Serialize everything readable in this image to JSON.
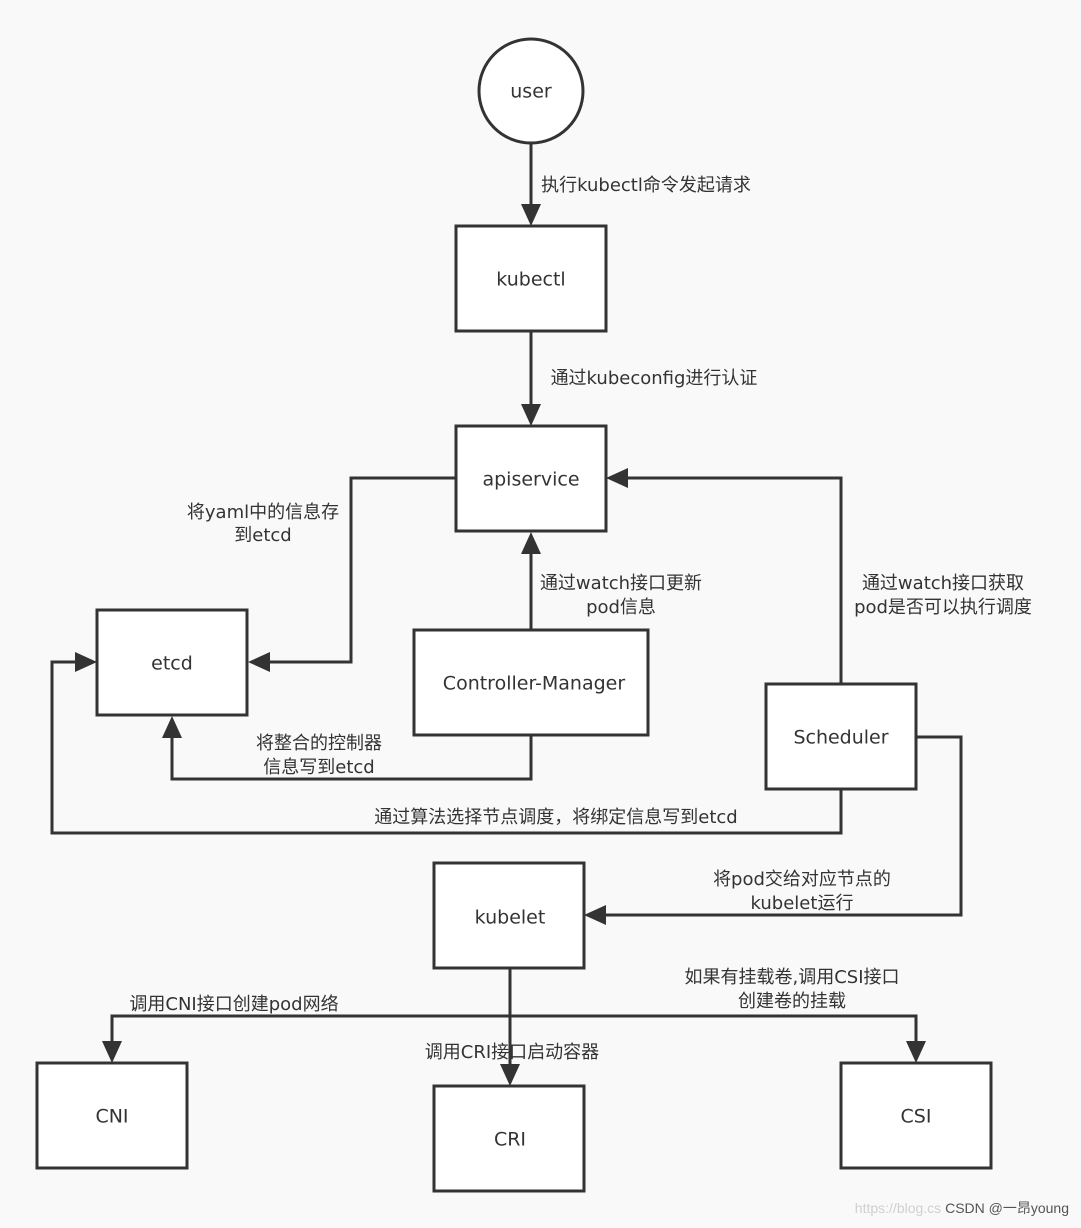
{
  "nodes": {
    "user": {
      "label": "user",
      "shape": "circle"
    },
    "kubectl": {
      "label": "kubectl",
      "shape": "rect"
    },
    "apiservice": {
      "label": "apiservice",
      "shape": "rect"
    },
    "etcd": {
      "label": "etcd",
      "shape": "rect"
    },
    "controller_manager": {
      "label": "Controller-Manager",
      "shape": "rect"
    },
    "scheduler": {
      "label": "Scheduler",
      "shape": "rect"
    },
    "kubelet": {
      "label": "kubelet",
      "shape": "rect"
    },
    "cni": {
      "label": "CNI",
      "shape": "rect"
    },
    "cri": {
      "label": "CRI",
      "shape": "rect"
    },
    "csi": {
      "label": "CSI",
      "shape": "rect"
    }
  },
  "edges": [
    {
      "id": "user-to-kubectl",
      "from": "user",
      "to": "kubectl",
      "label": [
        "执行kubectl命令发起请求"
      ]
    },
    {
      "id": "kubectl-to-apiservice",
      "from": "kubectl",
      "to": "apiservice",
      "label": [
        "通过kubeconfig进行认证"
      ]
    },
    {
      "id": "apiservice-to-etcd",
      "from": "apiservice",
      "to": "etcd",
      "label": [
        "将yaml中的信息存",
        "到etcd"
      ]
    },
    {
      "id": "controller-to-apiservice",
      "from": "controller_manager",
      "to": "apiservice",
      "label": [
        "通过watch接口更新",
        "pod信息"
      ]
    },
    {
      "id": "controller-to-etcd",
      "from": "controller_manager",
      "to": "etcd",
      "label": [
        "将整合的控制器",
        "信息写到etcd"
      ]
    },
    {
      "id": "scheduler-to-apiservice",
      "from": "scheduler",
      "to": "apiservice",
      "label": [
        "通过watch接口获取",
        "pod是否可以执行调度"
      ]
    },
    {
      "id": "scheduler-to-etcd",
      "from": "scheduler",
      "to": "etcd",
      "label": [
        "通过算法选择节点调度，将绑定信息写到etcd"
      ]
    },
    {
      "id": "scheduler-to-kubelet",
      "from": "scheduler",
      "to": "kubelet",
      "label": [
        "将pod交给对应节点的",
        "kubelet运行"
      ]
    },
    {
      "id": "kubelet-to-cni",
      "from": "kubelet",
      "to": "cni",
      "label": [
        "调用CNI接口创建pod网络"
      ]
    },
    {
      "id": "kubelet-to-cri",
      "from": "kubelet",
      "to": "cri",
      "label": [
        "调用CRI接口启动容器"
      ]
    },
    {
      "id": "kubelet-to-csi",
      "from": "kubelet",
      "to": "csi",
      "label": [
        "如果有挂载卷,调用CSI接口",
        "创建卷的挂载"
      ]
    }
  ],
  "watermark": {
    "url_faint": "https://blog.cs",
    "text": "CSDN @一昂young"
  },
  "colors": {
    "stroke": "#333333",
    "node_fill": "#ffffff",
    "background": "#f9f9f9",
    "text": "#333333"
  }
}
